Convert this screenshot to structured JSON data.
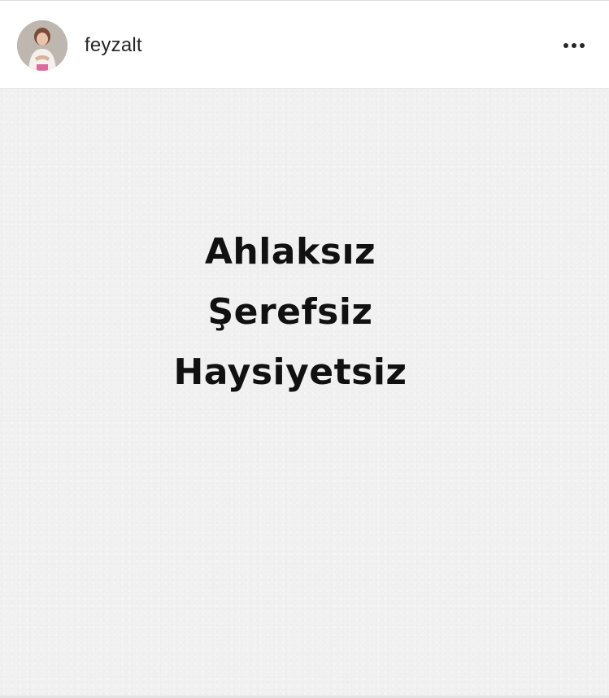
{
  "post": {
    "username": "feyzalt",
    "avatar_icon": "profile-photo-icon",
    "more_icon": "more-options-icon"
  },
  "image_text": {
    "lines": [
      "Ahlaksız",
      "Şerefsiz",
      "Haysiyetsiz"
    ]
  },
  "colors": {
    "text": "#262626",
    "image_background": "#f1f1f1",
    "image_text": "#111111"
  }
}
